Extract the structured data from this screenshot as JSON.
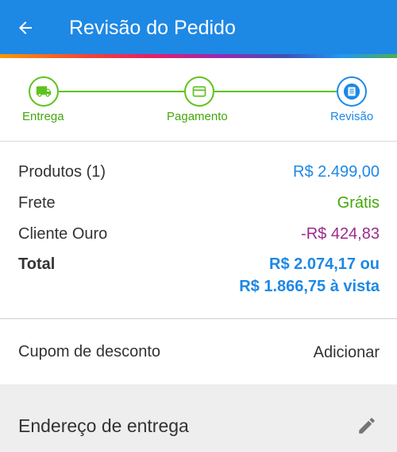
{
  "appbar": {
    "title": "Revisão do Pedido",
    "back_icon": "arrow-left-icon"
  },
  "colors": {
    "primary": "#1e88e5",
    "step_done": "#5ec31c",
    "free_green": "#43a70b",
    "discount_purple": "#9c2b8c",
    "address_bg": "#eeeeee"
  },
  "stepper": {
    "steps": [
      {
        "label": "Entrega",
        "icon": "truck-icon",
        "state": "done"
      },
      {
        "label": "Pagamento",
        "icon": "credit-card-icon",
        "state": "done"
      },
      {
        "label": "Revisão",
        "icon": "document-icon",
        "state": "current"
      }
    ]
  },
  "summary": {
    "products_label": "Produtos (1)",
    "products_value": "R$ 2.499,00",
    "shipping_label": "Frete",
    "shipping_value": "Grátis",
    "gold_label": "Cliente Ouro",
    "gold_value": "-R$ 424,83",
    "total_label": "Total",
    "total_value": "R$ 2.074,17 ou",
    "total_cash_value": "R$ 1.866,75 à vista"
  },
  "coupon": {
    "label": "Cupom de desconto",
    "action": "Adicionar"
  },
  "address": {
    "label": "Endereço de entrega",
    "edit_icon": "pencil-icon"
  }
}
